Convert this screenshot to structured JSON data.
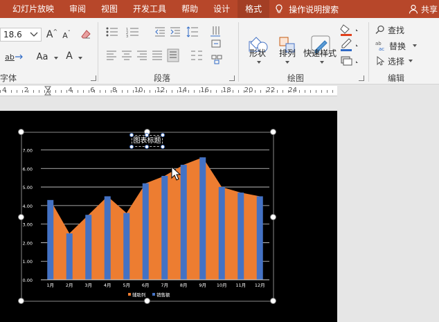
{
  "tabs": {
    "items": [
      "幻灯片放映",
      "审阅",
      "视图",
      "开发工具",
      "帮助",
      "设计",
      "格式"
    ],
    "selected": "格式",
    "tell_me": "操作说明搜索",
    "share": "共享"
  },
  "ribbon": {
    "font": {
      "group_label": "字体",
      "size_value": "18.6",
      "case_label": "Aa",
      "color_label": "A"
    },
    "paragraph": {
      "group_label": "段落"
    },
    "drawing": {
      "group_label": "绘图",
      "shapes_label": "形状",
      "arrange_label": "排列",
      "quick_styles_label": "快速样式"
    },
    "editing": {
      "group_label": "编辑",
      "find_label": "查找",
      "replace_label": "替换",
      "select_label": "选择"
    }
  },
  "ruler": {
    "labels": [
      "4",
      "2",
      "2",
      "4",
      "6",
      "8",
      "10",
      "12",
      "14",
      "16",
      "18",
      "20",
      "22",
      "24"
    ]
  },
  "chart_data": {
    "type": "bar",
    "title": "图表标题",
    "categories": [
      "1月",
      "2月",
      "3月",
      "4月",
      "5月",
      "6月",
      "7月",
      "8月",
      "9月",
      "10月",
      "11月",
      "12月"
    ],
    "series": [
      {
        "name": "辅助列",
        "chart": "area",
        "color": "#ed7d31",
        "values": [
          4.3,
          2.5,
          3.5,
          4.5,
          3.6,
          5.2,
          5.6,
          6.2,
          6.6,
          5.0,
          4.7,
          4.5
        ]
      },
      {
        "name": "销售额",
        "chart": "bar",
        "color": "#4472c4",
        "values": [
          4.3,
          2.5,
          3.5,
          4.5,
          3.6,
          5.2,
          5.6,
          6.2,
          6.6,
          5.0,
          4.7,
          4.5
        ]
      }
    ],
    "y_ticks": [
      "0.00",
      "1.00",
      "2.00",
      "3.00",
      "4.00",
      "5.00",
      "6.00",
      "7.00"
    ],
    "ylim": [
      0,
      7
    ],
    "grid": true,
    "legend_position": "bottom",
    "background": "#000000",
    "text_color": "#ffffff"
  }
}
